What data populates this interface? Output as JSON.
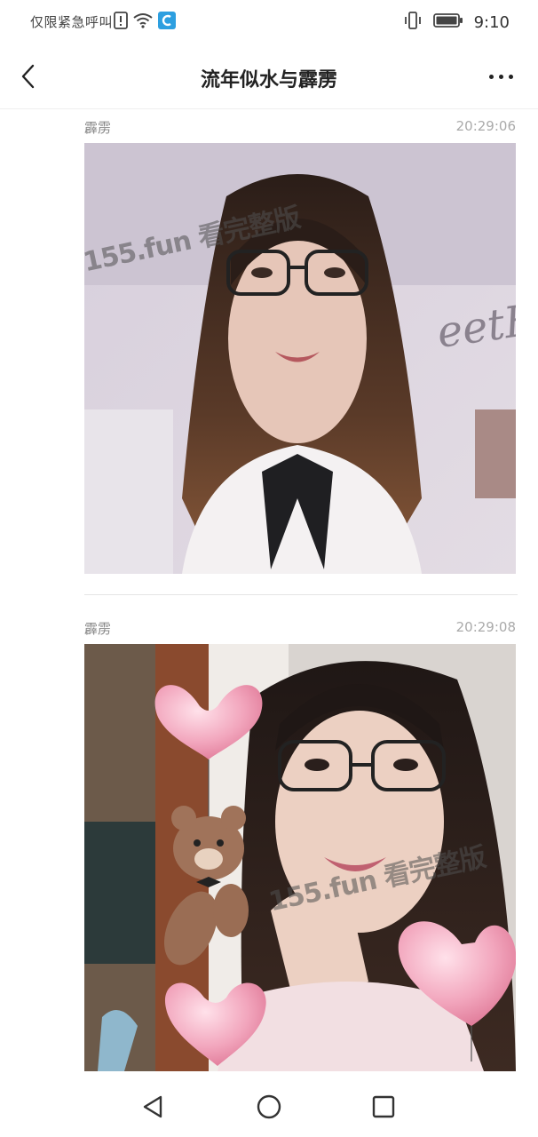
{
  "status_bar": {
    "carrier_text": "仅限紧急呼叫",
    "time": "9:10",
    "icons": [
      "sim-alert-icon",
      "wifi-icon",
      "app-notification-icon",
      "vibrate-icon",
      "battery-icon"
    ]
  },
  "header": {
    "title": "流年似水与霹雳",
    "back_icon": "chevron-left-icon",
    "more_icon": "more-dots-icon"
  },
  "posts": [
    {
      "author": "霹雳",
      "time": "20:29:06",
      "watermark": "155.fun 看完整版",
      "photo_description_icon": "selfie-photo"
    },
    {
      "author": "霹雳",
      "time": "20:29:08",
      "watermark": "155.fun 看完整版",
      "photo_description_icon": "selfie-photo-hearts-bear"
    }
  ],
  "nav": {
    "back_icon": "triangle-back-icon",
    "home_icon": "circle-home-icon",
    "recent_icon": "square-recent-icon"
  },
  "colors": {
    "background": "#ffffff",
    "text_primary": "#222222",
    "text_secondary": "#888888",
    "divider": "#e5e5e5"
  }
}
